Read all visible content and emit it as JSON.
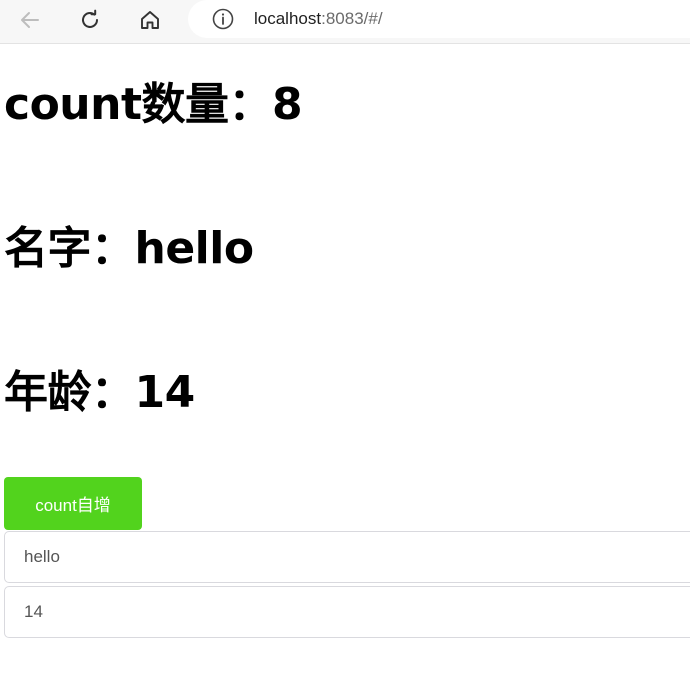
{
  "browser": {
    "url_host": "localhost",
    "url_rest": ":8083/#/",
    "icons": [
      "back-arrow-icon",
      "reload-icon",
      "home-icon",
      "info-icon"
    ]
  },
  "main": {
    "count_text": "count数量：8",
    "name_text": "名字：hello",
    "age_text": "年龄：14",
    "increment_button_label": "count自增",
    "name_input_value": "hello",
    "age_input_value": "14"
  },
  "colors": {
    "button_bg": "#52d31d",
    "button_text": "#ffffff"
  }
}
